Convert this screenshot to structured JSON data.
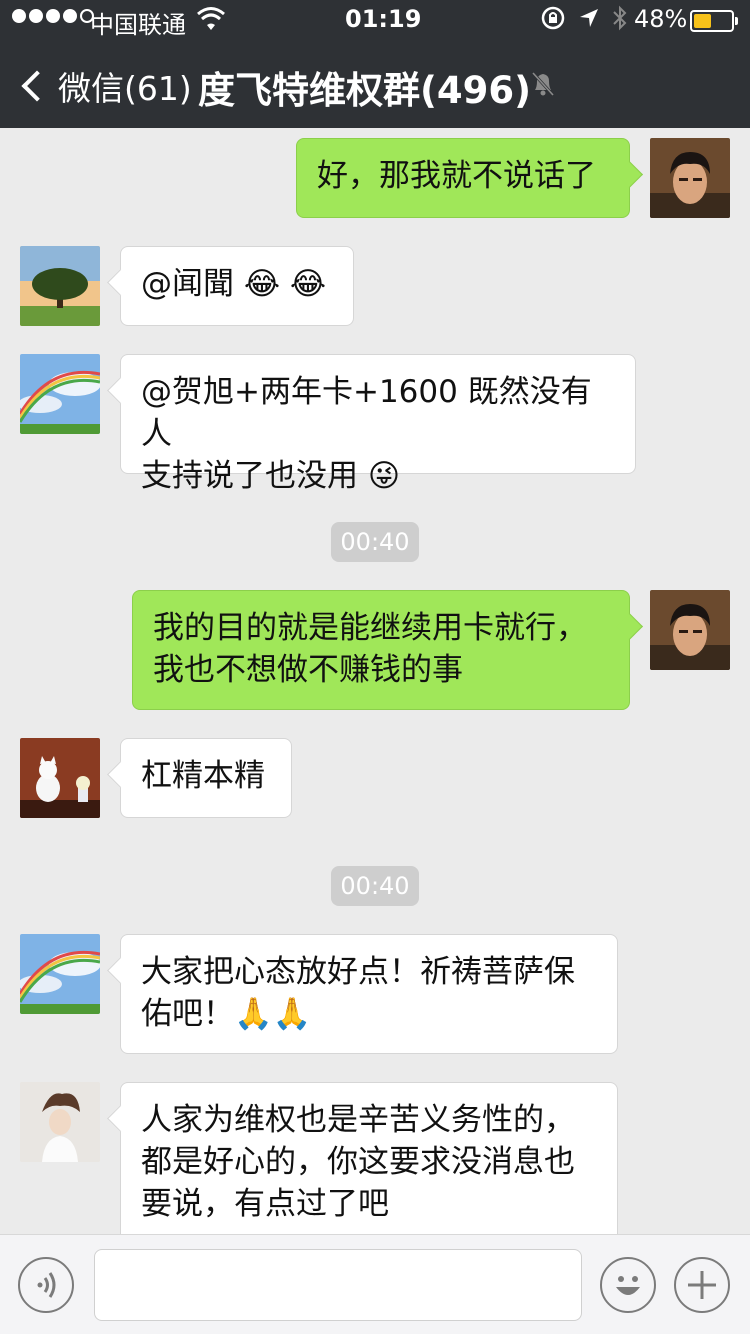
{
  "status_bar": {
    "carrier": "中国联通",
    "time": "01:19",
    "battery_percent": "48%",
    "battery_level": 0.48
  },
  "nav": {
    "back_label": "微信(61)",
    "title": "度飞特维权群(496)"
  },
  "messages": [
    {
      "direction": "out",
      "text": "好，那我就不说话了"
    },
    {
      "direction": "in",
      "text": "@闻聞 😂 😂"
    },
    {
      "direction": "in",
      "text": "@贺旭+两年卡+1600 既然没有人\n支持说了也没用 😜"
    },
    {
      "direction": "time",
      "text": "00:40"
    },
    {
      "direction": "out",
      "text": "我的目的就是能继续用卡就行，\n我也不想做不赚钱的事"
    },
    {
      "direction": "in",
      "text": "杠精本精"
    },
    {
      "direction": "time",
      "text": "00:40"
    },
    {
      "direction": "in",
      "text": "大家把心态放好点！祈祷菩萨保\n佑吧！🙏🙏"
    },
    {
      "direction": "in",
      "text": "人家为维权也是辛苦义务性的，\n都是好心的，你这要求没消息也\n要说，有点过了吧"
    }
  ],
  "input": {
    "value": "",
    "placeholder": ""
  },
  "colors": {
    "nav_bg": "#2e3135",
    "chat_bg": "#ebebeb",
    "out_bubble": "#a0e759",
    "in_bubble": "#ffffff"
  }
}
